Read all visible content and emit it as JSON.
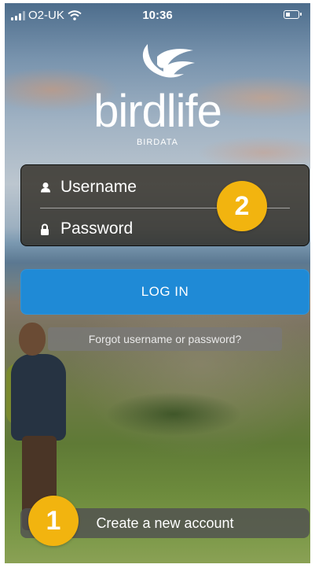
{
  "status_bar": {
    "carrier": "O2-UK",
    "time": "10:36",
    "icons": [
      "signal-bars-icon",
      "wifi-icon",
      "battery-icon"
    ]
  },
  "brand": {
    "logo_icon": "bird-wings-logo",
    "name": "birdlife",
    "subtitle": "BIRDATA"
  },
  "login": {
    "username_placeholder": "Username",
    "password_placeholder": "Password",
    "username_icon": "person-icon",
    "password_icon": "lock-icon",
    "login_label": "LOG IN",
    "forgot_label": "Forgot username or password?",
    "create_account_label": "Create a new account"
  },
  "annotations": {
    "badge_one": "1",
    "badge_two": "2"
  },
  "colors": {
    "login_button": "#1f8ad6",
    "badge": "#f2b40f"
  }
}
